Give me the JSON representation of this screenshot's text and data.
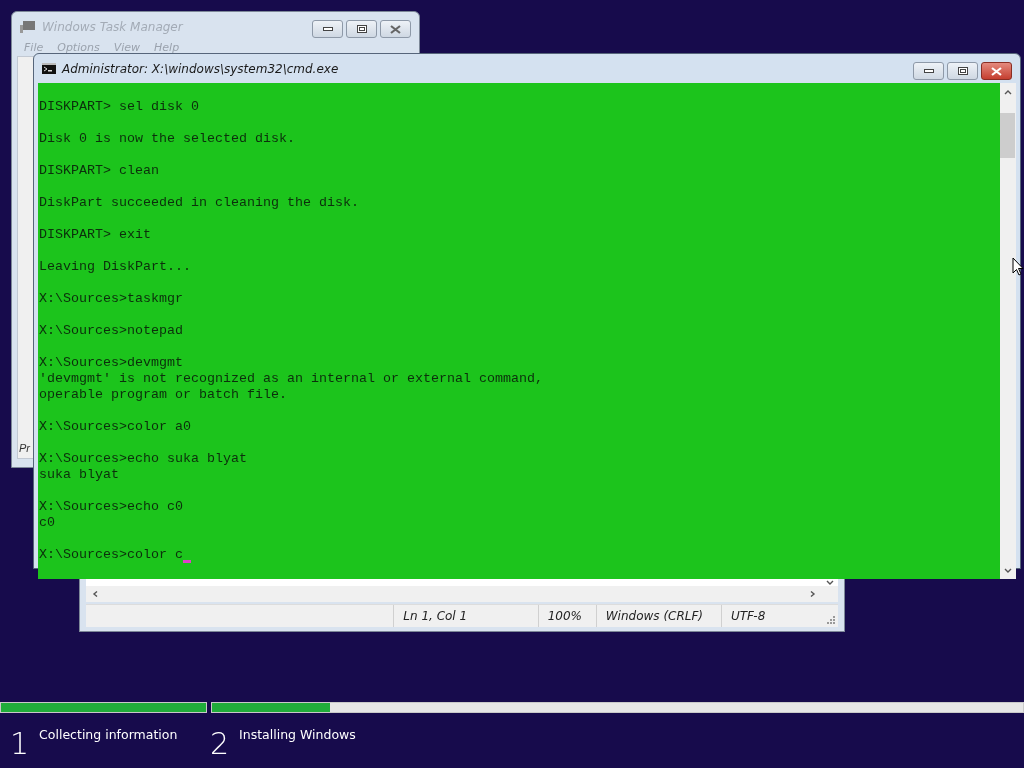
{
  "task_manager": {
    "title": "Windows Task Manager",
    "menu": [
      "File",
      "Options",
      "View",
      "Help"
    ],
    "status_text": "Pr"
  },
  "cmd": {
    "title": "Administrator: X:\\windows\\system32\\cmd.exe",
    "blocks": [
      [
        "DISKPART> sel disk 0"
      ],
      [
        "Disk 0 is now the selected disk."
      ],
      [
        "DISKPART> clean"
      ],
      [
        "DiskPart succeeded in cleaning the disk."
      ],
      [
        "DISKPART> exit"
      ],
      [
        "Leaving DiskPart..."
      ],
      [
        "X:\\Sources>taskmgr"
      ],
      [
        "X:\\Sources>notepad"
      ],
      [
        "X:\\Sources>devmgmt",
        "'devmgmt' is not recognized as an internal or external command,",
        "operable program or batch file."
      ],
      [
        "X:\\Sources>color a0"
      ],
      [
        "X:\\Sources>echo suka blyat",
        "suka blyat"
      ],
      [
        "X:\\Sources>echo c0",
        "c0"
      ],
      [
        "X:\\Sources>color c"
      ]
    ]
  },
  "notepad": {
    "status": [
      "Ln 1, Col 1",
      "100%",
      "Windows (CRLF)",
      "UTF-8"
    ]
  },
  "setup": {
    "steps": [
      {
        "number": "1",
        "label": "Collecting information",
        "level": 1
      },
      {
        "number": "2",
        "label": "Installing Windows",
        "level": 0.146
      }
    ]
  }
}
